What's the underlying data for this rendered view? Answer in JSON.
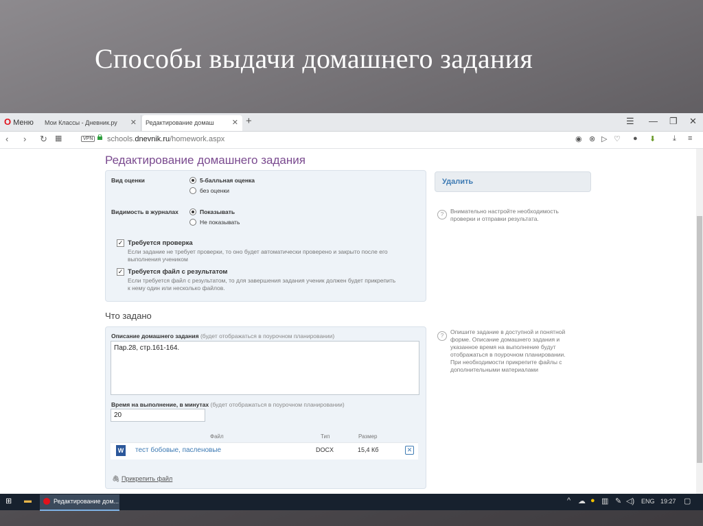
{
  "slide": {
    "title": "Способы выдачи домашнего задания"
  },
  "browser": {
    "menu_label": "Меню",
    "tabs": [
      {
        "label": "Мои Классы - Дневник.ру"
      },
      {
        "label": "Редактирование домаш"
      }
    ],
    "url_prefix": "schools.",
    "url_domain": "dnevnik.ru",
    "url_path": "/homework.aspx",
    "vpn_label": "VPN"
  },
  "page": {
    "heading": "Редактирование домашнего задания",
    "grade_type": {
      "label": "Вид оценки",
      "options": [
        "5-балльная оценка",
        "без оценки"
      ],
      "selected": 0
    },
    "journal_visibility": {
      "label": "Видимость в журналах",
      "options": [
        "Показывать",
        "Не показывать"
      ],
      "selected": 0
    },
    "check_required": {
      "label": "Требуется проверка",
      "hint_line1": "Если задание не требует проверки, то оно будет автоматически проверено и закрыто после его",
      "hint_line2": "выполнения учеником",
      "checked": true
    },
    "file_required": {
      "label": "Требуется файл с результатом",
      "hint_line1": "Если требуется файл с результатом, то для завершения задания ученик должен будет прикрепить",
      "hint_line2": "к нему один или несколько файлов.",
      "checked": true
    },
    "delete_label": "Удалить",
    "side_hint1": [
      "Внимательно настройте необходимость",
      "проверки и отправки результата."
    ],
    "section2_heading": "Что задано",
    "description_label": "Описание домашнего задания",
    "description_note": "(будет отображаться в поурочном планировании)",
    "description_value": "Пар.28, стр.161-164.",
    "time_label": "Время на выполнение, в минутах",
    "time_note": "(будет отображаться в поурочном планировании)",
    "time_value": "20",
    "side_hint2": [
      "Опишите задание в доступной и понятной",
      "форме. Описание домашнего задания и",
      "указанное время на выполнение будут",
      "отображаться в поурочном планировании.",
      "При необходимости прикрепите файлы с",
      "дополнительными материалами"
    ],
    "files_table": {
      "headers": [
        "Файл",
        "Тип",
        "Размер"
      ],
      "rows": [
        {
          "name": "тест бобовые, пасленовые",
          "type": "DOCX",
          "size": "15,4 Кб"
        }
      ]
    },
    "attach_label": "Прикрепить файл"
  },
  "taskbar": {
    "app_label": "Редактирование дом...",
    "lang": "ENG",
    "time": "19:27"
  }
}
